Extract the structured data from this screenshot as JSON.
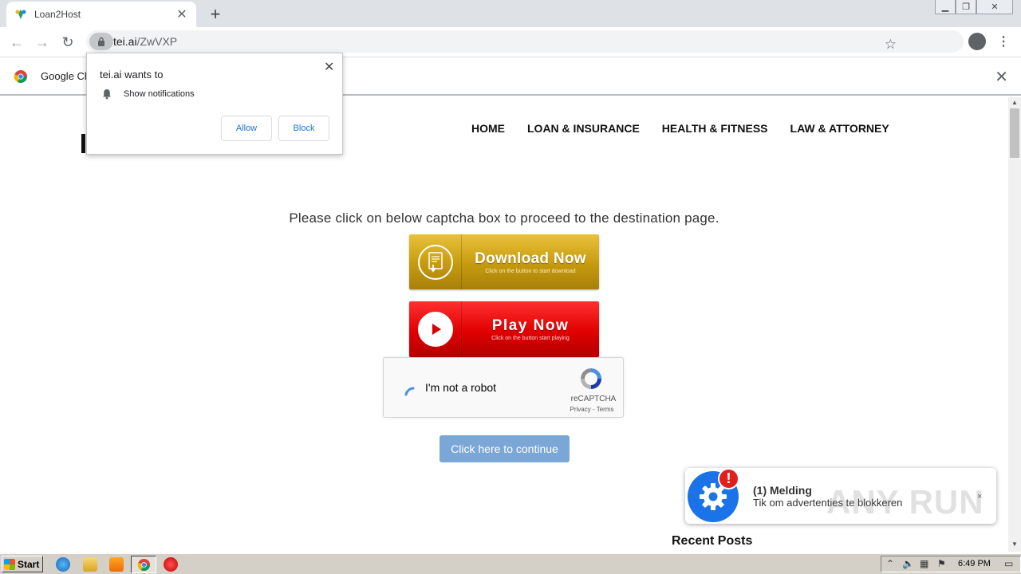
{
  "browser": {
    "tab_title": "Loan2Host",
    "url_host": "tei.ai",
    "url_path": "/ZwVXP",
    "infobar_text": "Google Ch"
  },
  "permission_popup": {
    "title": "tei.ai wants to",
    "item": "Show notifications",
    "allow_label": "Allow",
    "block_label": "Block"
  },
  "site": {
    "nav": [
      "HOME",
      "LOAN & INSURANCE",
      "HEALTH & FITNESS",
      "LAW & ATTORNEY"
    ],
    "prompt": "Please click on below captcha box to proceed to the destination page.",
    "download_button": {
      "label": "Download Now",
      "sub": "Click on the button to start download"
    },
    "play_button": {
      "label": "Play Now",
      "sub": "Click on the button start playing"
    },
    "recaptcha": {
      "label": "I'm not a robot",
      "brand": "reCAPTCHA",
      "links": "Privacy - Terms"
    },
    "continue_label": "Click here to continue",
    "recent_posts": "Recent Posts"
  },
  "toast": {
    "badge": "!",
    "title": "(1) Melding",
    "body": "Tik om advertenties te blokkeren",
    "close": "×"
  },
  "watermark": "ANY RUN",
  "taskbar": {
    "start_label": "Start",
    "clock": "6:49 PM"
  },
  "colors": {
    "download_gold": "#c69a0f",
    "play_red": "#e00000",
    "continue_blue": "#7aa7d6",
    "toast_blue": "#1a73e8",
    "badge_red": "#e0201c"
  }
}
